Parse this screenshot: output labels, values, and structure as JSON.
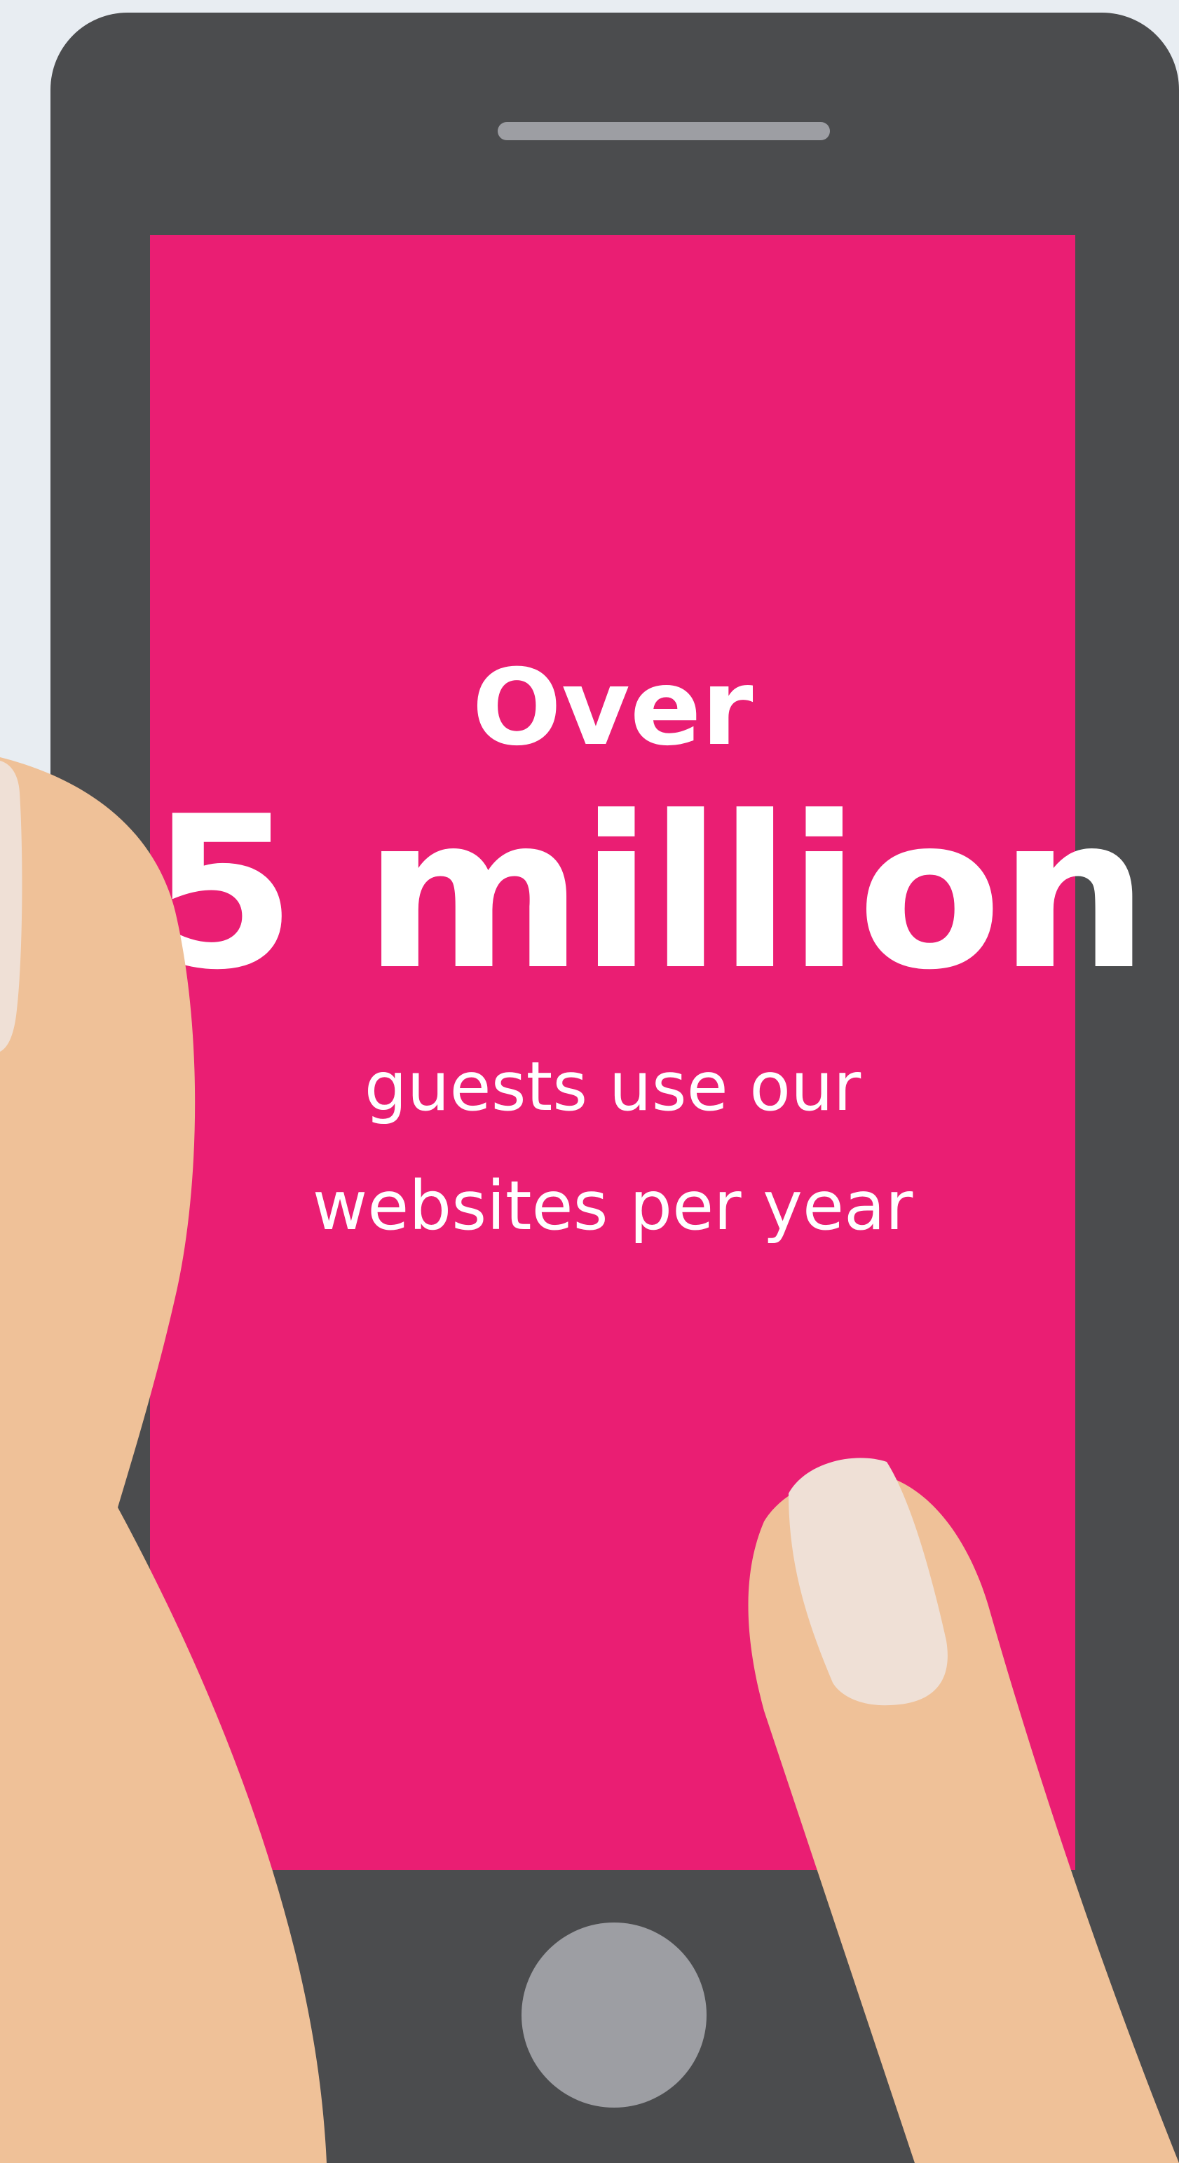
{
  "stat": {
    "prefix": "Over",
    "value": "5 million",
    "caption": "guests use our websites per year"
  },
  "colors": {
    "background": "#e8edf2",
    "phone_body": "#4b4c4e",
    "screen": "#ea1e73",
    "skin": "#efc198",
    "nail": "#efe0d6",
    "button": "#9d9ea3",
    "text": "#ffffff"
  }
}
